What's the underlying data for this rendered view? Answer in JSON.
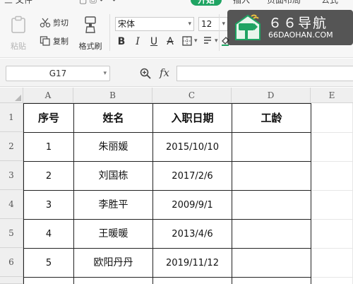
{
  "ribbon": {
    "menu": [
      "三 文件",
      "插入",
      "页面布局",
      "公式"
    ],
    "active_tab": "开始",
    "paste_label": "粘贴",
    "cut_label": "剪切",
    "copy_label": "复制",
    "format_painter_label": "格式刷",
    "font_name": "宋体",
    "font_size": "12",
    "bold_glyph": "B",
    "italic_glyph": "I",
    "underline_glyph": "U",
    "strike_glyph": "A"
  },
  "logo": {
    "title": "６６导航",
    "subtitle": "66DAOHAN.COM"
  },
  "formula_bar": {
    "cell_reference": "G17",
    "fx_label": "fx",
    "formula": ""
  },
  "sheet": {
    "columns": [
      "A",
      "B",
      "C",
      "D",
      "E"
    ],
    "rows": [
      "1",
      "2",
      "3",
      "4",
      "5",
      "6"
    ],
    "headers": [
      "序号",
      "姓名",
      "入职日期",
      "工龄"
    ],
    "records": [
      {
        "no": "1",
        "name": "朱丽媛",
        "date": "2015/10/10",
        "tenure": ""
      },
      {
        "no": "2",
        "name": "刘国栋",
        "date": "2017/2/6",
        "tenure": ""
      },
      {
        "no": "3",
        "name": "李胜平",
        "date": "2009/9/1",
        "tenure": ""
      },
      {
        "no": "4",
        "name": "王暖暖",
        "date": "2013/4/6",
        "tenure": ""
      },
      {
        "no": "5",
        "name": "欧阳丹丹",
        "date": "2019/11/12",
        "tenure": ""
      }
    ]
  },
  "colors": {
    "accent": "#1fa463",
    "table_border": "#222222",
    "header_bg": "#efefef"
  }
}
